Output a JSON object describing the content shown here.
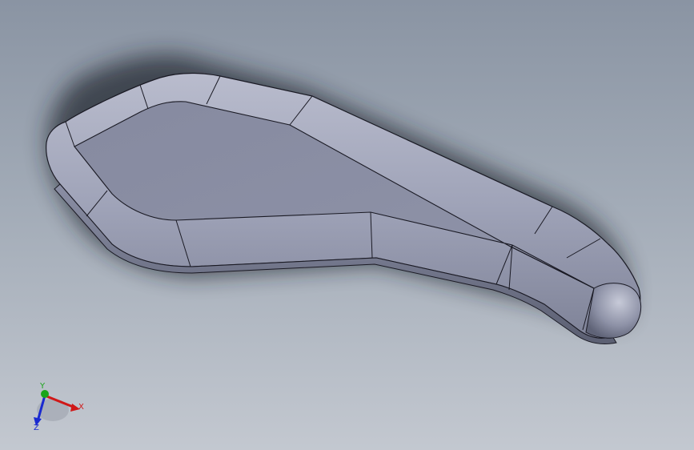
{
  "viewport": {
    "background_top": "#8a94a3",
    "background_bottom": "#c3c8d0",
    "model_color": "#8d92a6",
    "edge_color": "#1a1a24"
  },
  "triad": {
    "x_label": "X",
    "y_label": "Y",
    "z_label": "Z",
    "x_color": "#d01818",
    "y_color": "#1aa51a",
    "z_color": "#1a2ad0"
  }
}
